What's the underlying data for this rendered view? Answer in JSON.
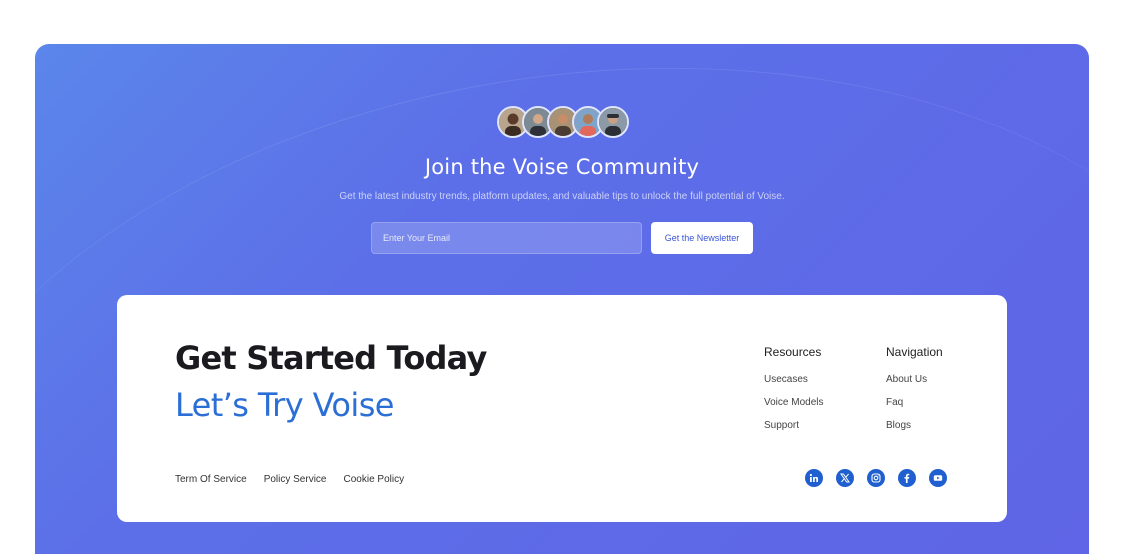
{
  "community": {
    "title": "Join the Voise Community",
    "subtitle": "Get the latest industry trends, platform updates, and valuable tips to unlock the full potential of Voise.",
    "email_placeholder": "Enter Your Email",
    "newsletter_label": "Get the Newsletter",
    "avatars": [
      "avatar-1",
      "avatar-2",
      "avatar-3",
      "avatar-4",
      "avatar-5"
    ]
  },
  "footer": {
    "headline": "Get Started Today",
    "subheadline": "Let’s Try Voise",
    "resources": {
      "heading": "Resources",
      "links": [
        "Usecases",
        "Voice Models",
        "Support"
      ]
    },
    "navigation": {
      "heading": "Navigation",
      "links": [
        "About Us",
        "Faq",
        "Blogs"
      ]
    },
    "legal_links": [
      "Term Of Service",
      "Policy Service",
      "Cookie Policy"
    ],
    "socials": [
      "linkedin-icon",
      "x-icon",
      "instagram-icon",
      "facebook-icon",
      "youtube-icon"
    ]
  },
  "colors": {
    "accent": "#2b6fd6",
    "background_gradient_start": "#5b86ea",
    "background_gradient_end": "#5f65e6",
    "social_icon": "#1f5fcf"
  }
}
